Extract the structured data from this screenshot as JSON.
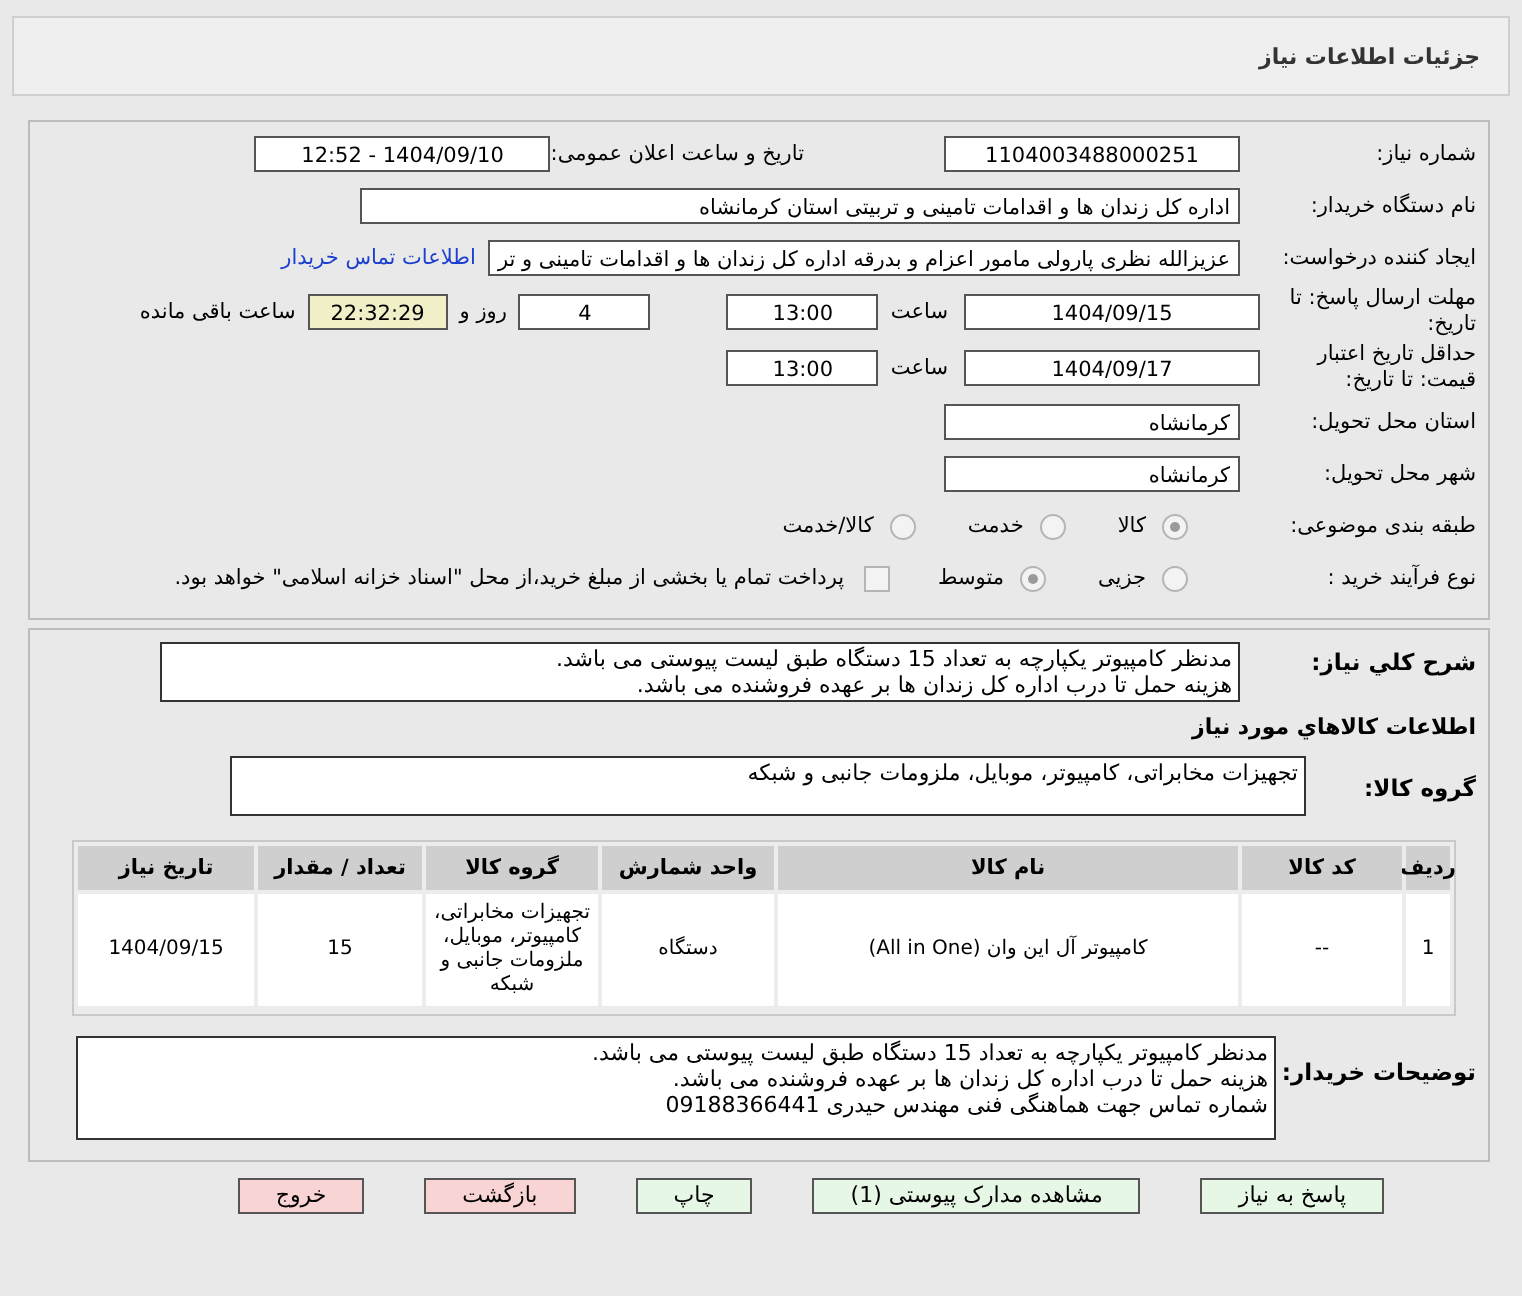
{
  "header": {
    "title": "جزئیات اطلاعات نیاز"
  },
  "fields": {
    "need_number": {
      "label": "شماره نیاز:",
      "value": "1104003488000251"
    },
    "announce": {
      "label": "تاریخ و ساعت اعلان عمومی:",
      "value": "1404/09/10 - 12:52"
    },
    "buyer": {
      "label": "نام دستگاه خریدار:",
      "value": "اداره کل زندان ها و اقدامات تامینی و تربیتی استان کرمانشاه"
    },
    "creator": {
      "label": "ایجاد کننده درخواست:",
      "value": "عزیزالله نظری پارولی مامور اعزام و بدرقه اداره کل زندان ها و اقدامات تامینی و تر",
      "link": "اطلاعات تماس خریدار"
    },
    "deadline": {
      "label": "مهلت ارسال پاسخ: تا تاریخ:",
      "date": "1404/09/15",
      "time_label": "ساعت",
      "time": "13:00",
      "days": "4",
      "days_label": "روز و",
      "remaining": "22:32:29",
      "remaining_label": "ساعت باقی مانده"
    },
    "validity": {
      "label": "حداقل تاریخ اعتبار قیمت: تا تاریخ:",
      "date": "1404/09/17",
      "time_label": "ساعت",
      "time": "13:00"
    },
    "province": {
      "label": "استان محل تحویل:",
      "value": "کرمانشاه"
    },
    "city": {
      "label": "شهر محل تحویل:",
      "value": "کرمانشاه"
    }
  },
  "category": {
    "label": "طبقه بندی موضوعی:",
    "options": [
      {
        "label": "کالا",
        "selected": true
      },
      {
        "label": "خدمت",
        "selected": false
      },
      {
        "label": "کالا/خدمت",
        "selected": false
      }
    ]
  },
  "process": {
    "label": "نوع فرآیند خرید :",
    "options": [
      {
        "label": "جزیی",
        "selected": false
      },
      {
        "label": "متوسط",
        "selected": true
      }
    ],
    "payment": {
      "checked": false,
      "label": "پرداخت تمام یا بخشی از مبلغ خرید،از محل \"اسناد خزانه اسلامی\" خواهد بود."
    }
  },
  "description": {
    "label": "شرح کلي نیاز:",
    "lines": [
      "مدنظر کامپیوتر یکپارچه به تعداد 15 دستگاه طبق لیست پیوستی می باشد.",
      "هزینه حمل تا درب اداره کل زندان ها بر عهده فروشنده می باشد."
    ]
  },
  "goods_heading": "اطلاعات کالاهاي مورد نیاز",
  "goods_group": {
    "label": "گروه کالا:",
    "value": "تجهیزات مخابراتی، کامپیوتر، موبایل، ملزومات جانبی و شبکه"
  },
  "table": {
    "columns": [
      "ردیف",
      "کد کالا",
      "نام کالا",
      "واحد شمارش",
      "گروه کالا",
      "تعداد / مقدار",
      "تاریخ نیاز"
    ],
    "rows": [
      [
        "1",
        "--",
        "کامپیوتر آل این وان (All in One)",
        "دستگاه",
        "تجهیزات مخابراتی، کامپیوتر، موبایل، ملزومات جانبی و شبکه",
        "15",
        "1404/09/15"
      ]
    ]
  },
  "buyer_notes": {
    "label": "توضیحات خریدار:",
    "lines": [
      "مدنظر کامپیوتر یکپارچه به تعداد 15 دستگاه طبق لیست پیوستی می باشد.",
      "هزینه حمل تا درب اداره کل زندان ها بر عهده فروشنده می باشد.",
      "شماره تماس جهت هماهنگی فنی  مهندس حیدری 09188366441"
    ]
  },
  "buttons": [
    {
      "label": "پاسخ به نیاز",
      "kind": "ok"
    },
    {
      "label": "مشاهده مدارک پیوستی (1)",
      "kind": "ok"
    },
    {
      "label": "چاپ",
      "kind": "ok"
    },
    {
      "label": "بازگشت",
      "kind": "danger"
    },
    {
      "label": "خروج",
      "kind": "danger"
    }
  ]
}
